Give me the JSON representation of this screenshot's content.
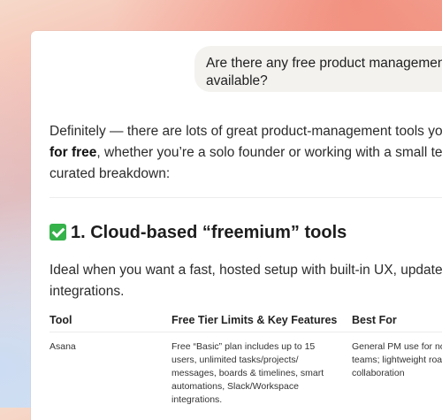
{
  "chat": {
    "user_message_line1": "Are there any free product management",
    "user_message_line2": "available?",
    "reply": {
      "intro_line1": "Definitely — there are lots of great product-management tools you",
      "intro_bold": "for free",
      "intro_line2_rest": ", whether you’re a solo founder or working with a small te",
      "intro_line3": "curated breakdown:",
      "section_title": "1. Cloud-based “freemium” tools",
      "section_desc_line1": "Ideal when you want a fast, hosted setup with built-in UX, update",
      "section_desc_line2": "integrations.",
      "table": {
        "headers": [
          "Tool",
          "Free Tier Limits & Key Features",
          "Best For"
        ],
        "rows": [
          {
            "tool": "Asana",
            "limits_lines": [
              "Free “Basic” plan includes up to 15",
              "users, unlimited tasks/projects/",
              "messages, boards & timelines, smart",
              "automations, Slack/Workspace",
              "integrations."
            ],
            "best_for_lines": [
              "General PM use for no",
              "teams; lightweight roa",
              "collaboration"
            ]
          }
        ]
      }
    }
  },
  "colors": {
    "bubble_bg": "#f3f2ef",
    "check_green": "#35b24a"
  },
  "icons": {
    "section_check": "white-heavy-check-mark-icon"
  }
}
